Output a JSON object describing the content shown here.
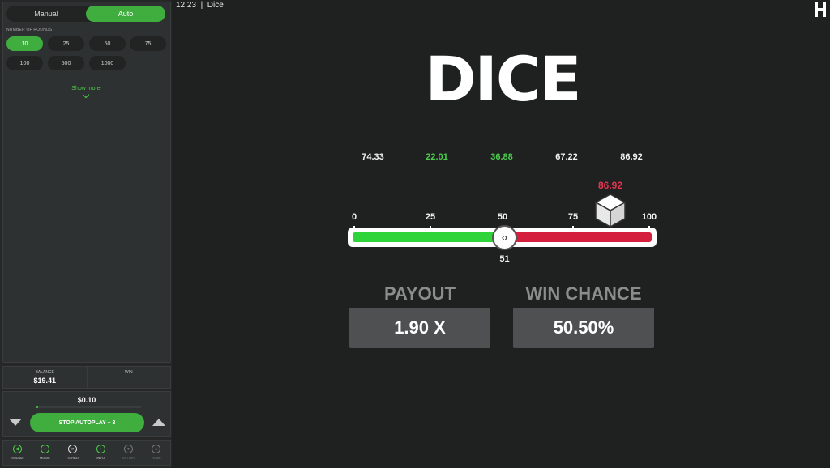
{
  "topbar": {
    "time": "12:23",
    "title": "Dice"
  },
  "sidebar": {
    "mode": {
      "manual": "Manual",
      "auto": "Auto",
      "active": "auto"
    },
    "rounds_label": "NUMBER OF ROUNDS",
    "rounds": [
      "10",
      "25",
      "50",
      "75",
      "100",
      "500",
      "1000"
    ],
    "rounds_active": "10",
    "show_more": "Show more",
    "balance_label": "BALANCE",
    "balance_value": "$19.41",
    "win_label": "WIN",
    "win_value": "",
    "bet_value": "$0.10",
    "bet_level": 0.02,
    "stop_autoplay": "STOP AUTOPLAY – 3",
    "bottom": [
      {
        "label": "SOUND",
        "icon": "sound-icon"
      },
      {
        "label": "MUSIC",
        "icon": "music-icon"
      },
      {
        "label": "TURBO",
        "icon": "turbo-icon"
      },
      {
        "label": "INFO",
        "icon": "info-icon"
      },
      {
        "label": "HISTORY",
        "icon": "history-icon"
      },
      {
        "label": "HOME",
        "icon": "home-icon"
      }
    ]
  },
  "main": {
    "title": "DICE",
    "history": [
      {
        "value": "74.33",
        "color": "white"
      },
      {
        "value": "22.01",
        "color": "green"
      },
      {
        "value": "36.88",
        "color": "green"
      },
      {
        "value": "67.22",
        "color": "white"
      },
      {
        "value": "86.92",
        "color": "white"
      }
    ],
    "ticks": [
      "0",
      "25",
      "50",
      "75",
      "100"
    ],
    "slider_value": "51",
    "result_value": "86.92",
    "payout_label": "PAYOUT",
    "payout_value": "1.90 X",
    "win_chance_label": "WIN CHANCE",
    "win_chance_value": "50.50%"
  },
  "colors": {
    "accent": "#3fae3f",
    "green_bar": "#2ed43a",
    "red_bar": "#d4203e",
    "result": "#e4334f"
  }
}
